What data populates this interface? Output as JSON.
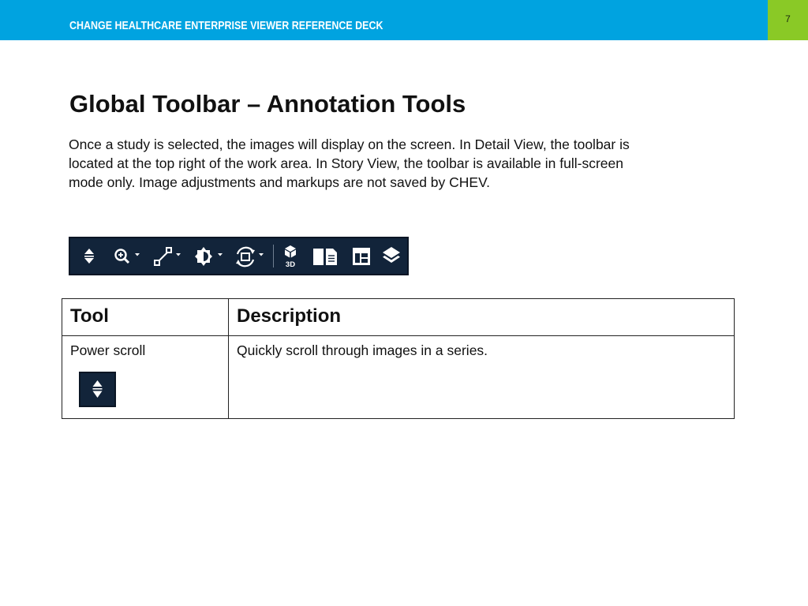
{
  "header": {
    "title": "CHANGE HEALTHCARE ENTERPRISE VIEWER REFERENCE DECK",
    "page_number": "7",
    "bar_color": "#00a3e0",
    "page_box_color": "#8ac926"
  },
  "slide": {
    "title": "Global Toolbar – Annotation Tools",
    "intro": "Once a study is selected, the images will display on the screen. In Detail View, the toolbar is located at the top right of the work area. In Story View, the toolbar is available in full-screen mode only. Image adjustments and markups are not saved by CHEV."
  },
  "toolbar": {
    "background": "#12243a",
    "icons": [
      "power-scroll-icon",
      "zoom-icon",
      "measure-line-icon",
      "window-level-icon",
      "rotate-flip-icon",
      "3d-icon",
      "layout-book-icon",
      "layout-grid-icon",
      "layers-icon"
    ],
    "label_3d": "3D"
  },
  "table": {
    "headers": [
      "Tool",
      "Description"
    ],
    "rows": [
      {
        "tool": "Power scroll",
        "icon": "power-scroll-icon",
        "description": "Quickly scroll through images in a series."
      }
    ]
  }
}
